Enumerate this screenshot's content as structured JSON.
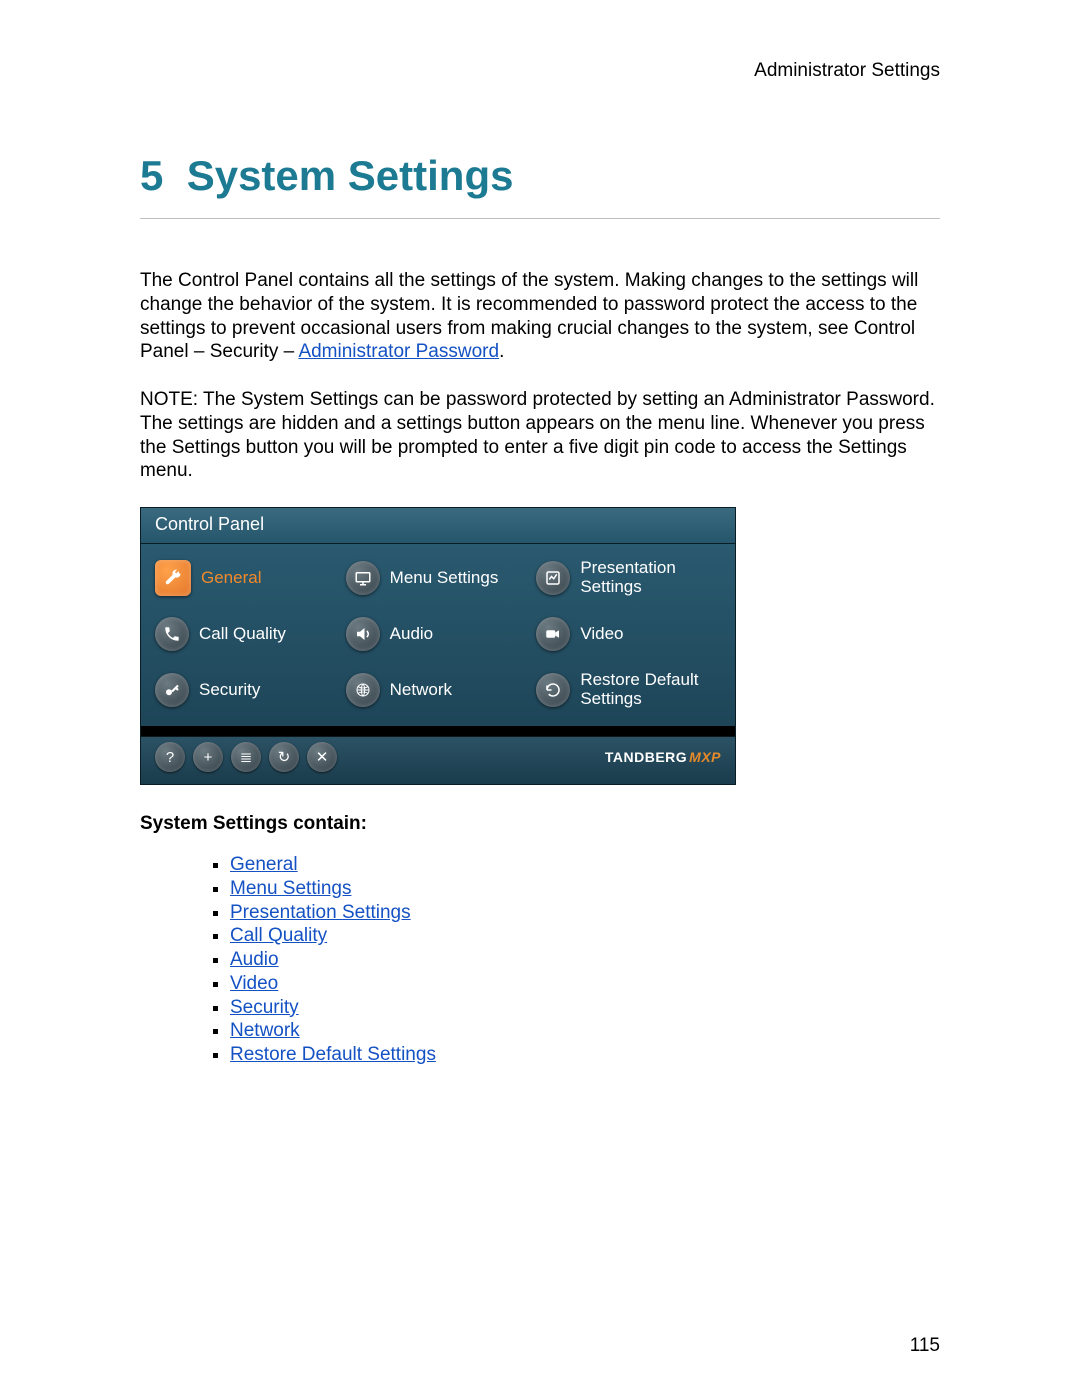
{
  "header": {
    "right": "Administrator Settings"
  },
  "chapter": {
    "number": "5",
    "title": "System Settings"
  },
  "para1_pre": "The Control Panel contains all the settings of the system. Making changes to the settings will change the behavior of the system. It is recommended to password protect the access to the settings to prevent occasional users from making crucial changes to the system, see Control Panel – Security – ",
  "para1_link": "Administrator Password",
  "para1_post": ".",
  "para2": "NOTE: The System Settings can be password protected by setting an Administrator Password. The settings are hidden and a settings button appears on the menu line. Whenever you press the Settings button you will be prompted to enter a five digit pin code to access the Settings menu.",
  "controlPanel": {
    "title": "Control Panel",
    "items": [
      {
        "label": "General",
        "icon": "wrench-icon",
        "active": true
      },
      {
        "label": "Menu Settings",
        "icon": "monitor-icon",
        "active": false
      },
      {
        "label": "Presentation\nSettings",
        "icon": "chart-icon",
        "active": false
      },
      {
        "label": "Call Quality",
        "icon": "phone-icon",
        "active": false
      },
      {
        "label": "Audio",
        "icon": "speaker-icon",
        "active": false
      },
      {
        "label": "Video",
        "icon": "camera-icon",
        "active": false
      },
      {
        "label": "Security",
        "icon": "key-icon",
        "active": false
      },
      {
        "label": "Network",
        "icon": "web-icon",
        "active": false
      },
      {
        "label": "Restore Default\nSettings",
        "icon": "restore-icon",
        "active": false
      }
    ],
    "actions": [
      {
        "name": "help-button",
        "glyph": "?"
      },
      {
        "name": "add-button",
        "glyph": "+"
      },
      {
        "name": "list-button",
        "glyph": "≣"
      },
      {
        "name": "refresh-button",
        "glyph": "↻"
      },
      {
        "name": "close-button",
        "glyph": "✕"
      }
    ],
    "brand": {
      "name": "TANDBERG",
      "suffix": "MXP"
    }
  },
  "listHeading": "System Settings contain:",
  "listItems": [
    "General",
    "Menu Settings",
    "Presentation Settings",
    "Call Quality",
    "Audio",
    "Video",
    "Security",
    "Network",
    "Restore Default Settings"
  ],
  "pageNumber": "115"
}
